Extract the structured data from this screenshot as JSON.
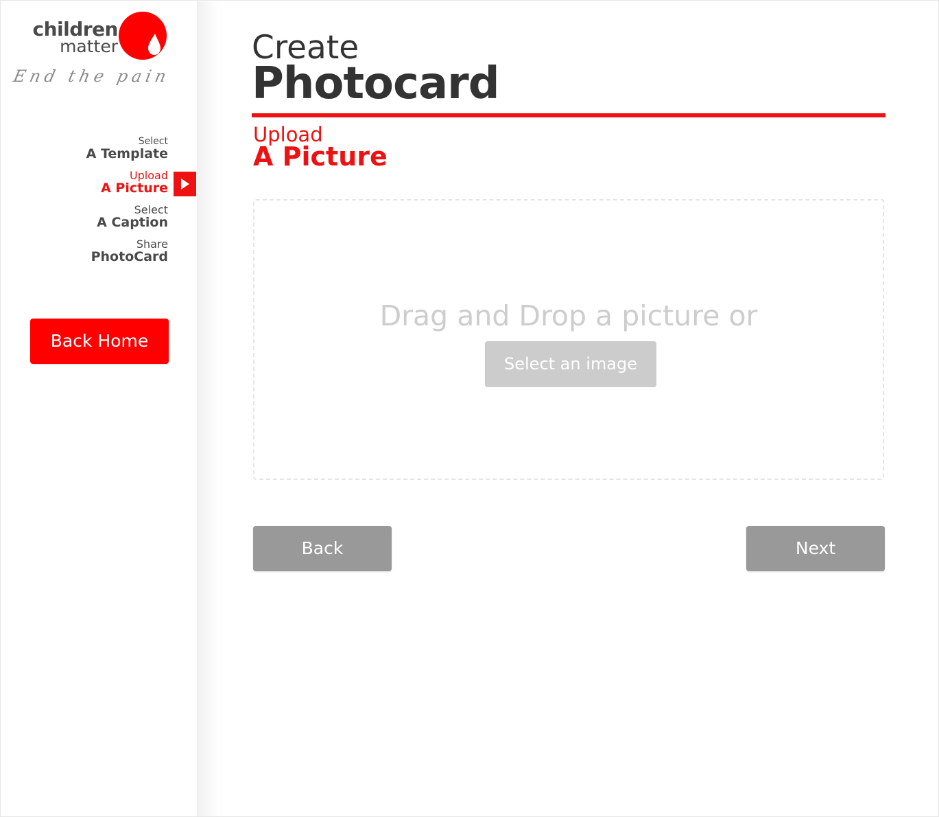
{
  "brand": {
    "line1": "children",
    "line2": "matter",
    "tagline": "End the pain",
    "accent_color": "#ee1111",
    "logo_icon": "drop-icon"
  },
  "sidebar": {
    "steps": [
      {
        "small": "Select",
        "big": "A Template",
        "active": false
      },
      {
        "small": "Upload",
        "big": "A Picture",
        "active": true
      },
      {
        "small": "Select",
        "big": "A Caption",
        "active": false
      },
      {
        "small": "Share",
        "big": "PhotoCard",
        "active": false
      }
    ],
    "active_marker_icon": "play-arrow-icon",
    "back_home_label": "Back Home"
  },
  "main": {
    "title_small": "Create",
    "title_big": "Photocard",
    "subtitle_small": "Upload",
    "subtitle_big": "A Picture",
    "dropzone": {
      "text": "Drag and Drop a picture or",
      "button_label": "Select an image"
    },
    "back_label": "Back",
    "next_label": "Next"
  }
}
